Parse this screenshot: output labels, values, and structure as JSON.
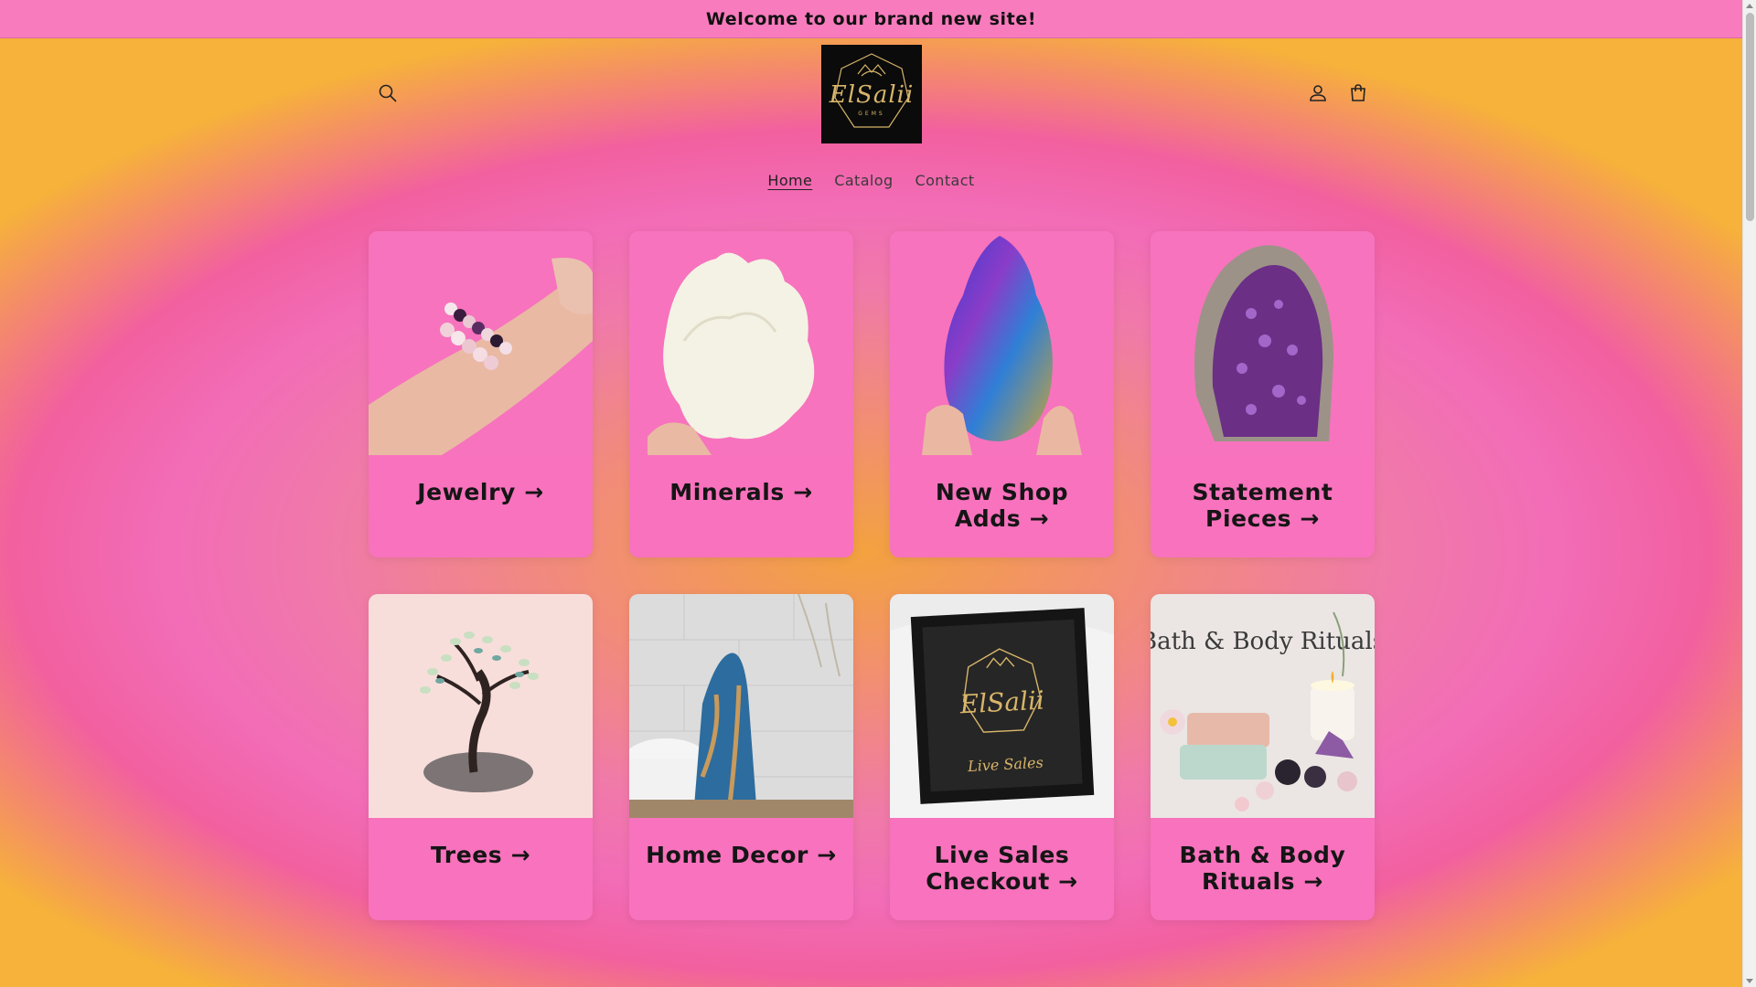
{
  "announcement": "Welcome to our brand new site!",
  "logo": {
    "name": "ElSalii",
    "sub": "GEMS"
  },
  "header_icons": {
    "search": "search-icon",
    "account": "account-icon",
    "cart": "cart-icon"
  },
  "nav": [
    {
      "label": "Home",
      "active": true
    },
    {
      "label": "Catalog",
      "active": false
    },
    {
      "label": "Contact",
      "active": false
    }
  ],
  "collections": [
    {
      "title": "Jewelry →",
      "image": "bracelets-on-wrist"
    },
    {
      "title": "Minerals →",
      "image": "white-mineral-cluster"
    },
    {
      "title": "New Shop Adds →",
      "image": "iridescent-bornite"
    },
    {
      "title": "Statement Pieces →",
      "image": "amethyst-cathedral"
    },
    {
      "title": "Trees →",
      "image": "gemstone-tree"
    },
    {
      "title": "Home Decor →",
      "image": "agate-slab"
    },
    {
      "title": "Live Sales Checkout →",
      "image": "live-sales-frame",
      "image_text": "Live Sales"
    },
    {
      "title": "Bath & Body Rituals →",
      "image": "bath-body-rituals",
      "image_text": "Bath & Body Rituals"
    }
  ],
  "colors": {
    "card": "#f872bd",
    "announcement_bg": "#f87bbd",
    "text": "#151515"
  }
}
